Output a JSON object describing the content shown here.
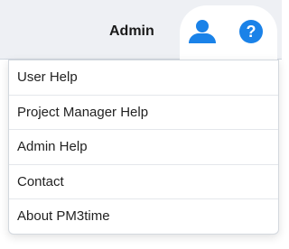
{
  "header": {
    "user_name": "Admin",
    "user_icon": "user-icon",
    "help_icon": "help-icon",
    "accent_color": "#1a82e8"
  },
  "help_menu": {
    "items": [
      {
        "label": "User Help"
      },
      {
        "label": "Project Manager Help"
      },
      {
        "label": "Admin Help"
      },
      {
        "label": "Contact"
      },
      {
        "label": "About PM3time"
      }
    ]
  }
}
